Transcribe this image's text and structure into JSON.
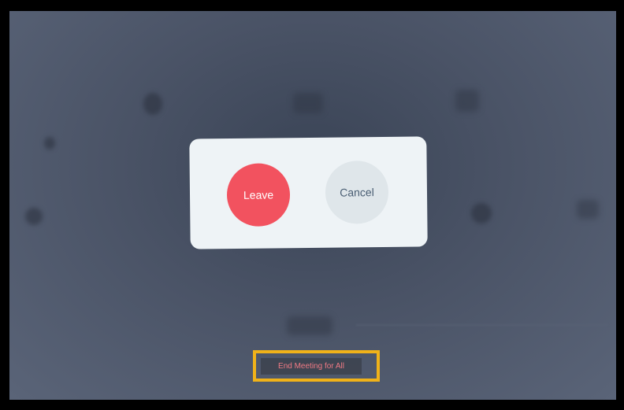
{
  "dialog": {
    "leave_label": "Leave",
    "cancel_label": "Cancel"
  },
  "footer": {
    "end_meeting_label": "End Meeting for All"
  },
  "colors": {
    "leave_button": "#f2525f",
    "cancel_button": "#dfe6ea",
    "highlight_border": "#f0b219",
    "end_meeting_text": "#f07a84"
  }
}
